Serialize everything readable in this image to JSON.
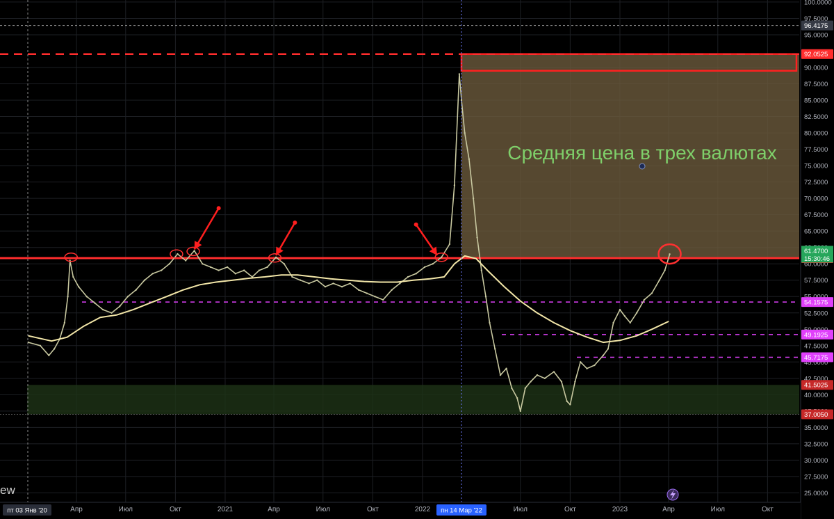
{
  "chart_data": {
    "type": "line",
    "title": "",
    "annotation_text": "Средняя цена в трех валютах",
    "ylim": [
      24,
      100
    ],
    "y_ticks": [
      25,
      27.5,
      30,
      32.5,
      35,
      37.5,
      40,
      42.5,
      45,
      47.5,
      50,
      52.5,
      55,
      57.5,
      60,
      62.5,
      65,
      67.5,
      70,
      72.5,
      75,
      77.5,
      80,
      82.5,
      85,
      87.5,
      90,
      95,
      97.5,
      100
    ],
    "y_tick_labels": [
      "25.0000",
      "27.5000",
      "30.0000",
      "32.5000",
      "35.0000",
      "37.5000",
      "40.0000",
      "42.5000",
      "45.0000",
      "47.5000",
      "50.0000",
      "52.5000",
      "55.0000",
      "57.5000",
      "60.0000",
      "62.5000",
      "65.0000",
      "67.5000",
      "70.0000",
      "72.5000",
      "75.0000",
      "77.5000",
      "80.0000",
      "82.5000",
      "85.0000",
      "87.5000",
      "90.0000",
      "95.0000",
      "97.5000",
      "100.0000"
    ],
    "x_ticks": [
      {
        "label": "Апр",
        "date": "2020-04-01"
      },
      {
        "label": "Июл",
        "date": "2020-07-01"
      },
      {
        "label": "Окт",
        "date": "2020-10-01"
      },
      {
        "label": "2021",
        "date": "2021-01-01"
      },
      {
        "label": "Апр",
        "date": "2021-04-01"
      },
      {
        "label": "Июл",
        "date": "2021-07-01"
      },
      {
        "label": "Окт",
        "date": "2021-10-01"
      },
      {
        "label": "2022",
        "date": "2022-01-01"
      },
      {
        "label": "Июл",
        "date": "2022-07-01"
      },
      {
        "label": "Окт",
        "date": "2022-10-01"
      },
      {
        "label": "2023",
        "date": "2023-01-01"
      },
      {
        "label": "Апр",
        "date": "2023-04-01"
      },
      {
        "label": "Июл",
        "date": "2023-07-01"
      },
      {
        "label": "Окт",
        "date": "2023-10-01"
      }
    ],
    "x_start_label": "пт 03 Янв '20",
    "x_cursor_label": "пн 14 Мар '22",
    "crosshair_price_label": "96.4175",
    "price_levels": [
      {
        "value": 92.0525,
        "label": "92.0525",
        "color": "#ff2d2d",
        "style": "dashed"
      },
      {
        "value": 60.8725,
        "label": "60.8725",
        "color": "#ff2d2d",
        "style": "solid"
      },
      {
        "value": 54.1575,
        "label": "54.1575",
        "color": "#e040fb",
        "style": "dashed"
      },
      {
        "value": 49.1925,
        "label": "49.1925",
        "color": "#e040fb",
        "style": "dashed"
      },
      {
        "value": 45.7175,
        "label": "45.7175",
        "color": "#e040fb",
        "style": "dashed"
      },
      {
        "value": 41.5025,
        "label": "41.5025",
        "color": "#c62828",
        "style": "none"
      },
      {
        "value": 37.005,
        "label": "37.0050",
        "color": "#c62828",
        "style": "none"
      }
    ],
    "last_price": {
      "value": 61.47,
      "label": "61.4700",
      "timer": "15:30:46",
      "color": "#26a65b"
    },
    "zones": [
      {
        "from_date": "2022-03-14",
        "to_date": "2023-12-31",
        "low": 61.0,
        "high": 92.0525,
        "color": "#6b5a3c"
      },
      {
        "from_date": "2020-01-01",
        "to_date": "2023-12-31",
        "low": 37.005,
        "high": 41.5025,
        "color": "#1e3317"
      }
    ],
    "series": [
      {
        "kind": "price",
        "color": "#c8c8a0",
        "points": [
          [
            "2020-01-03",
            48.0
          ],
          [
            "2020-01-25",
            47.5
          ],
          [
            "2020-02-10",
            46.0
          ],
          [
            "2020-02-20",
            47.0
          ],
          [
            "2020-03-01",
            48.5
          ],
          [
            "2020-03-10",
            51.0
          ],
          [
            "2020-03-16",
            55.0
          ],
          [
            "2020-03-20",
            60.5
          ],
          [
            "2020-03-26",
            58.0
          ],
          [
            "2020-04-05",
            56.5
          ],
          [
            "2020-04-20",
            55.0
          ],
          [
            "2020-05-05",
            54.0
          ],
          [
            "2020-05-20",
            53.0
          ],
          [
            "2020-06-05",
            52.5
          ],
          [
            "2020-06-20",
            53.5
          ],
          [
            "2020-07-05",
            55.0
          ],
          [
            "2020-07-20",
            56.0
          ],
          [
            "2020-08-05",
            57.5
          ],
          [
            "2020-08-20",
            58.5
          ],
          [
            "2020-09-05",
            59.0
          ],
          [
            "2020-09-20",
            60.0
          ],
          [
            "2020-10-05",
            61.5
          ],
          [
            "2020-10-20",
            60.5
          ],
          [
            "2020-11-05",
            62.0
          ],
          [
            "2020-11-20",
            60.0
          ],
          [
            "2020-12-05",
            59.5
          ],
          [
            "2020-12-20",
            59.0
          ],
          [
            "2021-01-05",
            59.5
          ],
          [
            "2021-01-20",
            58.5
          ],
          [
            "2021-02-05",
            59.0
          ],
          [
            "2021-02-20",
            58.0
          ],
          [
            "2021-03-05",
            59.0
          ],
          [
            "2021-03-20",
            59.5
          ],
          [
            "2021-04-05",
            61.0
          ],
          [
            "2021-04-20",
            60.0
          ],
          [
            "2021-05-05",
            58.0
          ],
          [
            "2021-05-20",
            57.5
          ],
          [
            "2021-06-05",
            57.0
          ],
          [
            "2021-06-20",
            57.5
          ],
          [
            "2021-07-05",
            56.5
          ],
          [
            "2021-07-20",
            57.0
          ],
          [
            "2021-08-05",
            56.5
          ],
          [
            "2021-08-20",
            57.0
          ],
          [
            "2021-09-05",
            56.0
          ],
          [
            "2021-09-20",
            55.5
          ],
          [
            "2021-10-05",
            55.0
          ],
          [
            "2021-10-20",
            54.5
          ],
          [
            "2021-11-05",
            56.0
          ],
          [
            "2021-11-20",
            57.0
          ],
          [
            "2021-12-05",
            58.0
          ],
          [
            "2021-12-20",
            58.5
          ],
          [
            "2022-01-05",
            59.5
          ],
          [
            "2022-01-20",
            60.0
          ],
          [
            "2022-02-05",
            61.0
          ],
          [
            "2022-02-20",
            63.0
          ],
          [
            "2022-03-01",
            72.0
          ],
          [
            "2022-03-10",
            89.0
          ],
          [
            "2022-03-14",
            85.0
          ],
          [
            "2022-03-20",
            80.0
          ],
          [
            "2022-03-28",
            76.0
          ],
          [
            "2022-04-05",
            70.0
          ],
          [
            "2022-04-12",
            64.0
          ],
          [
            "2022-04-20",
            59.0
          ],
          [
            "2022-04-28",
            55.0
          ],
          [
            "2022-05-05",
            51.0
          ],
          [
            "2022-05-15",
            47.0
          ],
          [
            "2022-05-25",
            43.0
          ],
          [
            "2022-06-05",
            44.0
          ],
          [
            "2022-06-15",
            41.0
          ],
          [
            "2022-06-25",
            39.5
          ],
          [
            "2022-07-01",
            37.5
          ],
          [
            "2022-07-10",
            41.0
          ],
          [
            "2022-07-20",
            42.0
          ],
          [
            "2022-08-01",
            43.0
          ],
          [
            "2022-08-15",
            42.5
          ],
          [
            "2022-09-01",
            43.5
          ],
          [
            "2022-09-15",
            42.0
          ],
          [
            "2022-09-25",
            39.0
          ],
          [
            "2022-10-01",
            38.5
          ],
          [
            "2022-10-10",
            42.0
          ],
          [
            "2022-10-20",
            45.0
          ],
          [
            "2022-11-01",
            44.0
          ],
          [
            "2022-11-15",
            44.5
          ],
          [
            "2022-12-01",
            46.0
          ],
          [
            "2022-12-10",
            47.0
          ],
          [
            "2022-12-20",
            51.0
          ],
          [
            "2023-01-01",
            53.0
          ],
          [
            "2023-01-10",
            52.0
          ],
          [
            "2023-01-20",
            51.0
          ],
          [
            "2023-02-01",
            52.5
          ],
          [
            "2023-02-15",
            54.5
          ],
          [
            "2023-03-01",
            55.5
          ],
          [
            "2023-03-15",
            57.5
          ],
          [
            "2023-03-25",
            59.0
          ],
          [
            "2023-04-03",
            61.47
          ]
        ]
      },
      {
        "kind": "moving_average",
        "color": "#f2e6a8",
        "points": [
          [
            "2020-01-03",
            49.0
          ],
          [
            "2020-02-15",
            48.2
          ],
          [
            "2020-03-15",
            48.8
          ],
          [
            "2020-04-15",
            50.5
          ],
          [
            "2020-05-15",
            51.8
          ],
          [
            "2020-06-15",
            52.2
          ],
          [
            "2020-07-15",
            53.0
          ],
          [
            "2020-08-15",
            54.0
          ],
          [
            "2020-09-15",
            55.0
          ],
          [
            "2020-10-15",
            56.0
          ],
          [
            "2020-11-15",
            56.8
          ],
          [
            "2020-12-15",
            57.2
          ],
          [
            "2021-01-15",
            57.5
          ],
          [
            "2021-02-15",
            57.8
          ],
          [
            "2021-03-15",
            58.0
          ],
          [
            "2021-04-15",
            58.3
          ],
          [
            "2021-05-15",
            58.3
          ],
          [
            "2021-06-15",
            58.0
          ],
          [
            "2021-07-15",
            57.7
          ],
          [
            "2021-08-15",
            57.5
          ],
          [
            "2021-09-15",
            57.3
          ],
          [
            "2021-10-15",
            57.2
          ],
          [
            "2021-11-15",
            57.2
          ],
          [
            "2021-12-15",
            57.5
          ],
          [
            "2022-01-15",
            57.7
          ],
          [
            "2022-02-10",
            58.0
          ],
          [
            "2022-03-01",
            60.0
          ],
          [
            "2022-03-20",
            61.2
          ],
          [
            "2022-04-10",
            60.8
          ],
          [
            "2022-05-01",
            59.0
          ],
          [
            "2022-06-01",
            56.5
          ],
          [
            "2022-07-01",
            54.3
          ],
          [
            "2022-08-01",
            52.5
          ],
          [
            "2022-09-01",
            51.0
          ],
          [
            "2022-10-01",
            49.8
          ],
          [
            "2022-11-01",
            48.8
          ],
          [
            "2022-12-01",
            48.0
          ],
          [
            "2023-01-01",
            48.3
          ],
          [
            "2023-02-01",
            49.0
          ],
          [
            "2023-03-01",
            50.0
          ],
          [
            "2023-04-01",
            51.2
          ]
        ]
      }
    ],
    "highlight_circles": [
      {
        "date": "2020-03-22",
        "value": 61.0
      },
      {
        "date": "2020-10-03",
        "value": 61.5
      },
      {
        "date": "2020-11-03",
        "value": 61.9
      },
      {
        "date": "2021-04-03",
        "value": 60.9
      },
      {
        "date": "2022-02-05",
        "value": 61.0
      },
      {
        "date": "2023-04-03",
        "value": 61.5
      }
    ],
    "arrows": [
      {
        "from_date": "2020-12-20",
        "from_value": 68.5,
        "to_date": "2020-11-05",
        "to_value": 62.2
      },
      {
        "from_date": "2021-05-10",
        "from_value": 66.3,
        "to_date": "2021-04-05",
        "to_value": 61.3
      },
      {
        "from_date": "2021-12-20",
        "from_value": 66.0,
        "to_date": "2022-01-28",
        "to_value": 61.3
      }
    ],
    "axis_badge_icon": "lightning-icon",
    "watermark_fragment": "ew"
  }
}
